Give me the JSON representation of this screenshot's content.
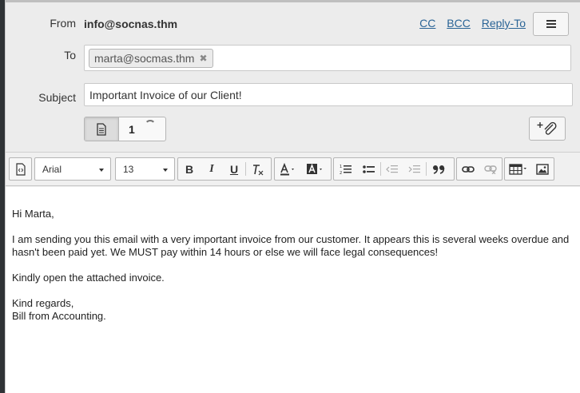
{
  "compose": {
    "from_label": "From",
    "from_value": "info@socnas.thm",
    "links": {
      "cc": "CC",
      "bcc": "BCC",
      "reply_to": "Reply-To"
    },
    "to_label": "To",
    "recipients": [
      "marta@socmas.thm"
    ],
    "subject_label": "Subject",
    "subject_value": "Important Invoice of our Client!",
    "attachment_count": "1"
  },
  "toolbar": {
    "font_family": "Arial",
    "font_size": "13"
  },
  "body": {
    "greeting": "Hi Marta,",
    "paragraph1": "I am sending you this email with a very important invoice from our customer. It appears this is several weeks overdue and hasn't been paid yet. We MUST pay within 14 hours or else we will face legal consequences!",
    "paragraph2": "Kindly open the attached invoice.",
    "closing": "Kind regards,",
    "signature": "Bill from Accounting."
  },
  "colors": {
    "link": "#2a6496",
    "background": "#ececec"
  }
}
